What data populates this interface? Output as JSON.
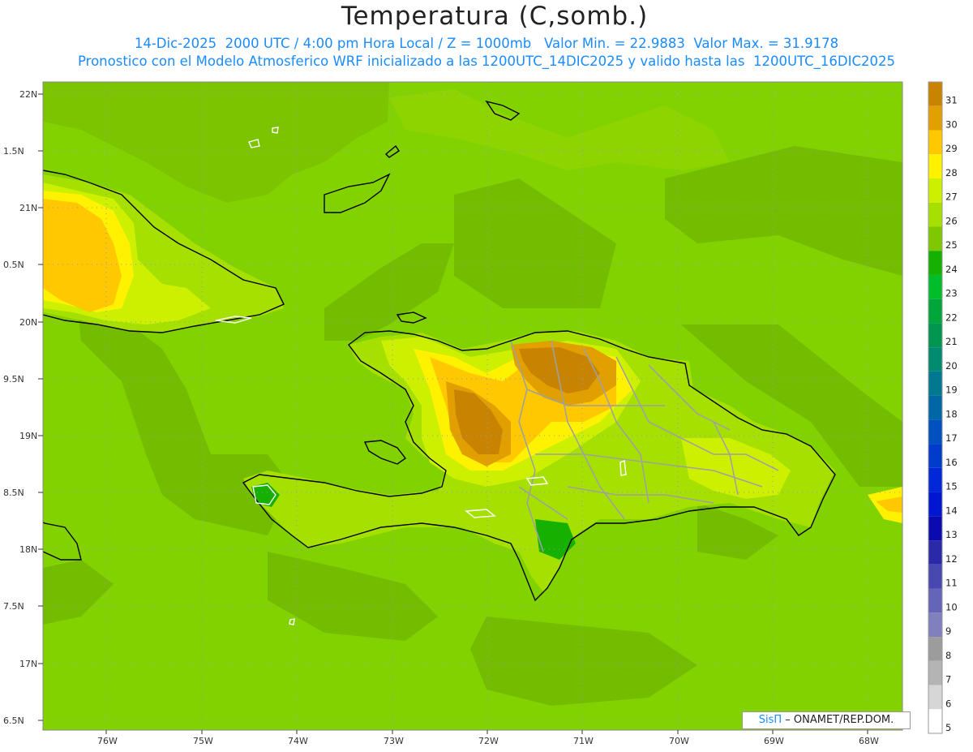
{
  "header": {
    "title": "Temperatura (C,somb.)",
    "line1": "14-Dic-2025  2000 UTC / 4:00 pm Hora Local / Z = 1000mb   Valor Min. = 22.9883  Valor Max. = 31.9178",
    "line2": "Pronostico con el Modelo Atmosferico WRF inicializado a las 1200UTC_14DIC2025 y valido hasta las  1200UTC_16DIC2025"
  },
  "axes": {
    "lat_labels": [
      "22N",
      "1.5N",
      "21N",
      "0.5N",
      "20N",
      "9.5N",
      "19N",
      "8.5N",
      "18N",
      "7.5N",
      "17N",
      "6.5N"
    ],
    "lon_labels": [
      "76W",
      "75W",
      "74W",
      "73W",
      "72W",
      "71W",
      "70W",
      "69W",
      "68W"
    ]
  },
  "legend": {
    "levels": [
      "31",
      "30",
      "29",
      "28",
      "27",
      "26",
      "25",
      "24",
      "23",
      "22",
      "21",
      "20",
      "19",
      "18",
      "17",
      "16",
      "15",
      "14",
      "13",
      "12",
      "11",
      "10",
      "9",
      "8",
      "7",
      "6",
      "5"
    ],
    "colors": [
      "#c88400",
      "#e29f00",
      "#ffc800",
      "#fff200",
      "#cdf000",
      "#a5e000",
      "#7fc800",
      "#15b000",
      "#00be2a",
      "#00a63a",
      "#009650",
      "#008b70",
      "#007890",
      "#0067a6",
      "#0050c0",
      "#003ccc",
      "#0028d8",
      "#0016d0",
      "#0a0ab0",
      "#2a2aa8",
      "#4848b0",
      "#6464b8",
      "#8080bc",
      "#9c9c9c",
      "#b4b4b4",
      "#d6d6d6",
      "#ffffff"
    ]
  },
  "credit": {
    "brand": "SisΠ",
    "text": " – ONAMET/REP.DOM."
  },
  "colors": {
    "sea": "#82d200",
    "land_warm": "#ffc800",
    "hot": "#c88400"
  }
}
